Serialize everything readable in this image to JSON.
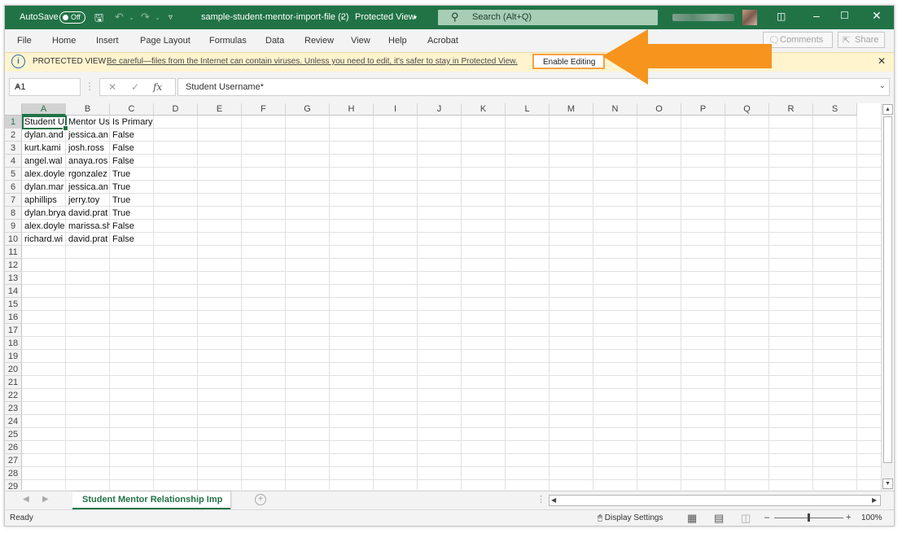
{
  "titlebar": {
    "autosave_label": "AutoSave",
    "autosave_state": "Off",
    "file_title": "sample-student-mentor-import-file (2)",
    "view_mode": "Protected View",
    "search_placeholder": "Search (Alt+Q)"
  },
  "menu": {
    "items": [
      "File",
      "Home",
      "Insert",
      "Page Layout",
      "Formulas",
      "Data",
      "Review",
      "View",
      "Help",
      "Acrobat"
    ],
    "comments_label": "Comments",
    "share_label": "Share"
  },
  "banner": {
    "title": "PROTECTED VIEW",
    "message": "Be careful—files from the Internet can contain viruses. Unless you need to edit, it's safer to stay in Protected View.",
    "enable_button": "Enable Editing",
    "highlight_color": "#f5a143",
    "arrow_color": "#f7941e"
  },
  "formula_bar": {
    "name_box": "A1",
    "content": "Student Username*"
  },
  "grid": {
    "columns": [
      "A",
      "B",
      "C",
      "D",
      "E",
      "F",
      "G",
      "H",
      "I",
      "J",
      "K",
      "L",
      "M",
      "N",
      "O",
      "P",
      "Q",
      "R",
      "S"
    ],
    "row_numbers": [
      "1",
      "2",
      "3",
      "4",
      "5",
      "6",
      "7",
      "8",
      "9",
      "10",
      "11",
      "12",
      "13",
      "14",
      "15",
      "16",
      "17",
      "18",
      "19",
      "20",
      "21",
      "22",
      "23",
      "24",
      "25",
      "26",
      "27",
      "28",
      "29"
    ],
    "rows": [
      [
        "Student U",
        "Mentor Us",
        "Is Primary"
      ],
      [
        "dylan.and",
        "jessica.an",
        "False"
      ],
      [
        "kurt.kami",
        "josh.ross",
        "False"
      ],
      [
        "angel.wal",
        "anaya.ros",
        "False"
      ],
      [
        "alex.doyle",
        "rgonzalez",
        "True"
      ],
      [
        "dylan.mar",
        "jessica.an",
        "True"
      ],
      [
        "aphillips",
        "jerry.toy",
        "True"
      ],
      [
        "dylan.brya",
        "david.prat",
        "True"
      ],
      [
        "alex.doyle",
        "marissa.sh",
        "False"
      ],
      [
        "richard.wi",
        "david.prat",
        "False"
      ]
    ]
  },
  "sheets": {
    "active": "Student Mentor Relationship Imp"
  },
  "status": {
    "ready": "Ready",
    "display_settings": "Display Settings",
    "zoom": "100%"
  },
  "colors": {
    "excel_green": "#217346",
    "banner_bg": "#fff4ce"
  }
}
